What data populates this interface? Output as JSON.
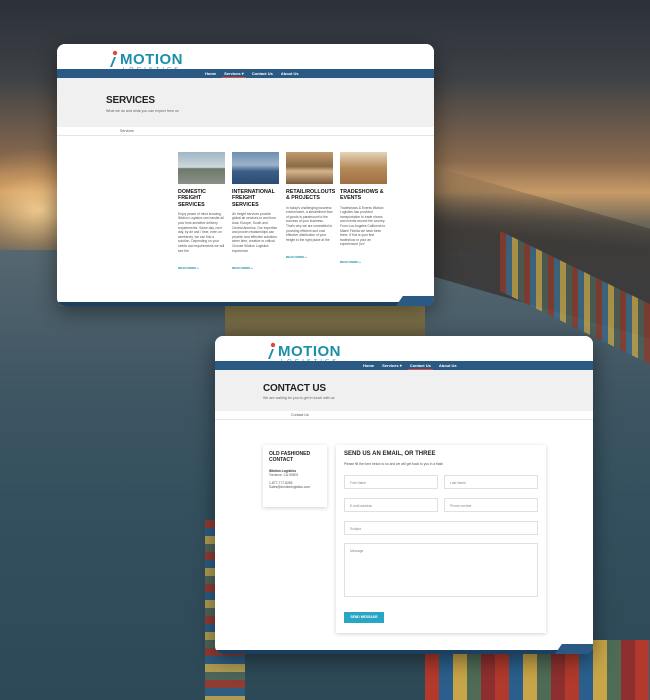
{
  "brand": {
    "name": "MOTION",
    "tagline": "LOGISTICS",
    "accent_color": "#1c8fa8",
    "nav_color": "#2a5a83",
    "active_color": "#e0473e"
  },
  "nav": {
    "items": [
      "Home",
      "Services",
      "Contact Us",
      "About Us"
    ],
    "dropdown_glyph": "▾"
  },
  "services_page": {
    "title": "SERVICES",
    "subtitle": "What we do and what you can expect from us",
    "breadcrumb": "Services",
    "active_nav": "Services",
    "items": [
      {
        "title": "DOMESTIC FREIGHT SERVICES",
        "text": "Enjoy peace of mind knowing iMotion Logistics can handle all your time-sensitive delivery requirements. Same day, next day, by air and / time, even on weekends, we can find a solution. Depending on your needs and requirements we will see the",
        "more": "READ MORE »",
        "image": "warehouse-yard"
      },
      {
        "title": "INTERNATIONAL FREIGHT SERVICES",
        "text": "Air freight services provide global air services to and from Asia, Europe, South and Central America. Our expertise and proven relationships can provide cost effective solutions when time, creative or critical. Choose iMotion Logistics experience",
        "more": "READ MORE »",
        "image": "port-cranes"
      },
      {
        "title": "RETAIL/ROLLOUTS & PROJECTS",
        "text": "In today's challenging business environment, a streamlined flow of goods is paramount to the success of your business. That's why we are committed to providing efficient and cost effective distribution of your freight to the right place at the",
        "more": "READ MORE »",
        "image": "pallet-boxes"
      },
      {
        "title": "TRADESHOWS & EVENTS",
        "text": "Tradeshows & Events iMotion Logistics has provided transportation to trade shows and events around the country. From Los Angeles California to Miami Florida we have been there. If this is your first tradeshow or your an experienced 'pro'",
        "more": "READ MORE »",
        "image": "stacked-cartons"
      }
    ]
  },
  "contact_page": {
    "title": "CONTACT US",
    "subtitle": "We are waiting for you to get in touch with us",
    "breadcrumb": "Contact Us",
    "active_nav": "Contact Us",
    "left_card": {
      "heading": "OLD FASHIONED CONTACT",
      "company": "iMotion Logistics",
      "city": "Torrance, CA 90503",
      "phone": "1-877-777-8265",
      "email": "Sales@imotionlogistics.com"
    },
    "form": {
      "heading": "SEND US AN EMAIL, OR THREE",
      "intro": "Please fill the form below to us and we will get back to you in a flash",
      "first_name_placeholder": "First Name",
      "last_name_placeholder": "Last Name",
      "email_placeholder": "E-mail address",
      "phone_placeholder": "Phone number",
      "subject_placeholder": "Subject",
      "message_placeholder": "Message",
      "submit_label": "SEND MESSAGE"
    }
  }
}
